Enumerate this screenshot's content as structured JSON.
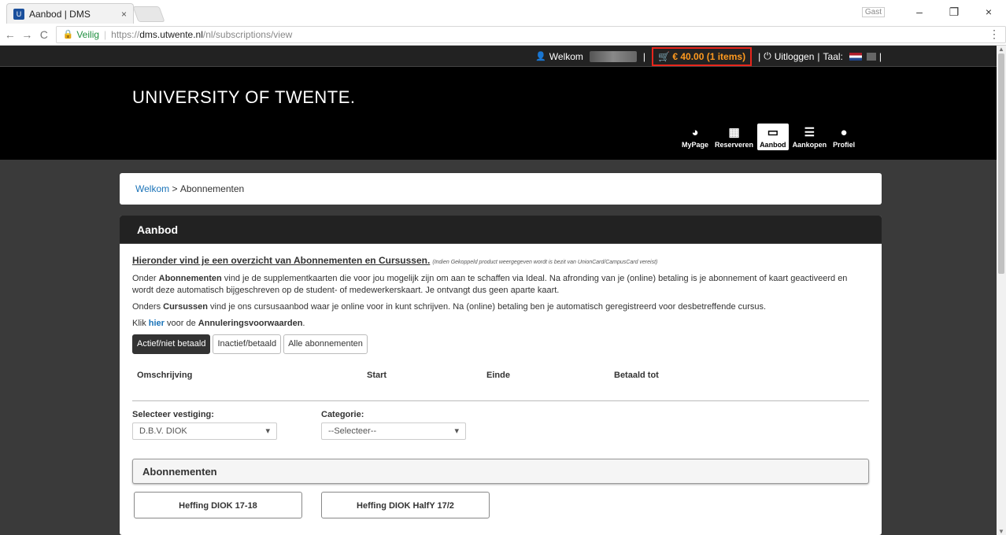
{
  "browser": {
    "tab_title": "Aanbod | DMS",
    "tab_close": "×",
    "guest_label": "Gast",
    "window_controls": [
      "–",
      "❐",
      "×"
    ],
    "secure_label": "Veilig",
    "url_scheme": "https://",
    "url_host": "dms.utwente.nl",
    "url_path": "/nl/subscriptions/view"
  },
  "topbar": {
    "welcome": "Welkom",
    "cart": "€ 40.00 (1 items)",
    "logout": "Uitloggen",
    "language_label": "Taal:"
  },
  "header": {
    "logo": "UNIVERSITY OF TWENTE.",
    "nav": [
      {
        "label": "MyPage",
        "icon": "dashboard-icon"
      },
      {
        "label": "Reserveren",
        "icon": "calendar-icon"
      },
      {
        "label": "Aanbod",
        "icon": "card-icon"
      },
      {
        "label": "Aankopen",
        "icon": "list-icon"
      },
      {
        "label": "Profiel",
        "icon": "user-icon"
      }
    ]
  },
  "breadcrumb": {
    "home": "Welkom",
    "separator": " > ",
    "current": "Abonnementen"
  },
  "panel": {
    "title": "Aanbod",
    "intro_title": "Hieronder vind je een overzicht van Abonnementen en Cursussen.",
    "intro_note": "(Indien Gekoppeld product weergegeven wordt is bezit van UnionCard/CampusCard vereist)",
    "p1_a": "Onder ",
    "p1_b": "Abonnementen",
    "p1_c": " vind je de supplementkaarten die voor jou mogelijk zijn om aan te schaffen via Ideal. Na afronding van je (online) betaling is je abonnement of kaart geactiveerd en wordt deze automatisch bijgeschreven op de student- of medewerkerskaart. Je ontvangt dus geen aparte kaart.",
    "p2_a": "Onders ",
    "p2_b": "Cursussen",
    "p2_c": " vind je ons cursusaanbod waar je online voor in kunt schrijven. Na (online) betaling ben je automatisch geregistreerd voor desbetreffende  cursus.",
    "p3_a": "Klik ",
    "p3_link": "hier",
    "p3_b": " voor de ",
    "p3_c": "Annuleringsvoorwaarden",
    "p3_d": ".",
    "filters": [
      "Actief/niet betaald",
      "Inactief/betaald",
      "Alle abonnementen"
    ],
    "columns": [
      "Omschrijving",
      "Start",
      "Einde",
      "Betaald tot"
    ],
    "location_label": "Selecteer vestiging:",
    "location_value": "D.B.V. DIOK",
    "category_label": "Categorie:",
    "category_value": "--Selecteer--",
    "subscriptions_title": "Abonnementen",
    "cards": [
      "Heffing DIOK 17-18",
      "Heffing DIOK HalfY 17/2"
    ]
  },
  "colors": {
    "cart_border": "#e8261c",
    "cart_text": "#ff9a1f",
    "link": "#1a73b8"
  }
}
